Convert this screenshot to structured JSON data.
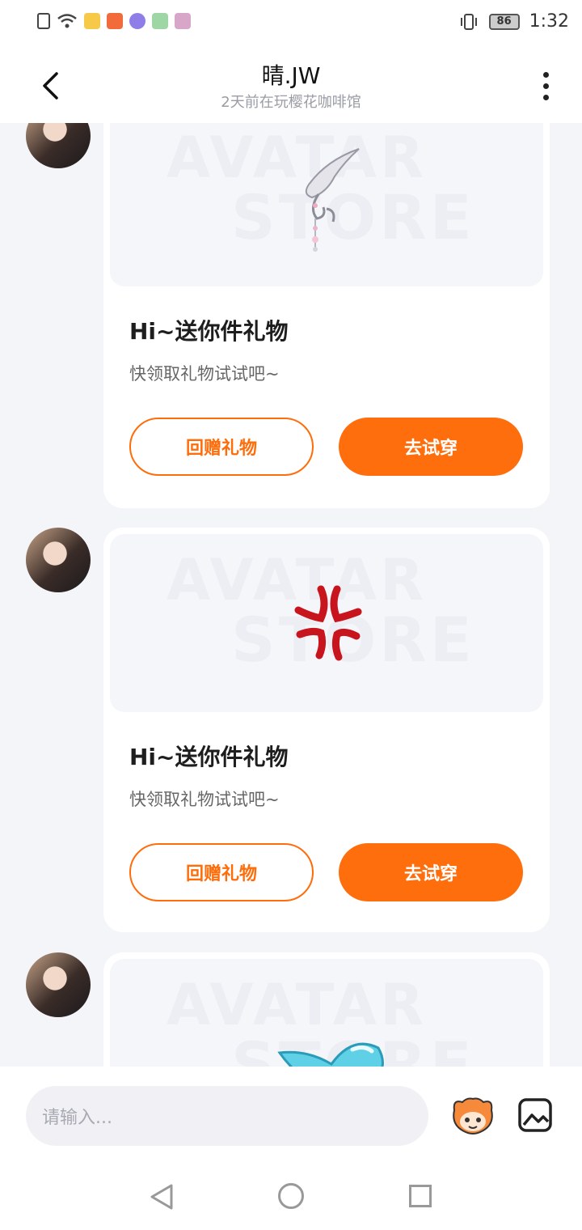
{
  "status_bar": {
    "time": "1:32",
    "battery": "86"
  },
  "header": {
    "title": "晴.JW",
    "subtitle": "2天前在玩樱花咖啡馆"
  },
  "messages": [
    {
      "title": "Hi~送你件礼物",
      "subtitle": "快领取礼物试试吧~",
      "return_label": "回赠礼物",
      "try_label": "去试穿",
      "item_icon": "silver-hairpin-icon"
    },
    {
      "title": "Hi~送你件礼物",
      "subtitle": "快领取礼物试试吧~",
      "return_label": "回赠礼物",
      "try_label": "去试穿",
      "item_icon": "anger-mark-icon"
    },
    {
      "item_icon": "blue-drop-icon"
    }
  ],
  "watermark": {
    "line1": "AVATAR",
    "line2": "STORE"
  },
  "input_bar": {
    "placeholder": "请输入..."
  },
  "colors": {
    "accent": "#ff6e0c",
    "background": "#f4f5f9"
  }
}
